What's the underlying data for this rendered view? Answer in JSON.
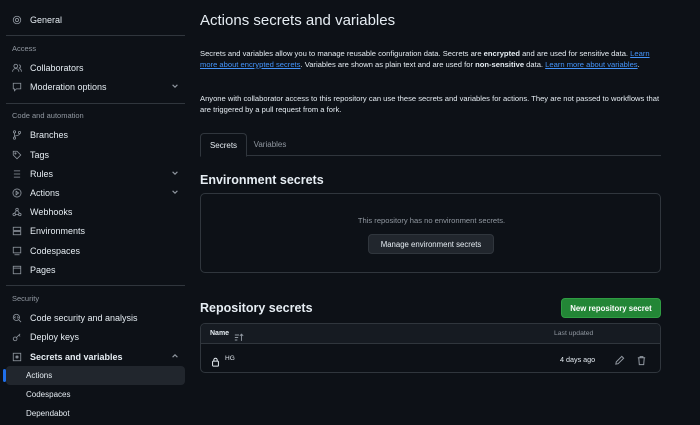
{
  "sidebar": {
    "general": "General",
    "access_heading": "Access",
    "collaborators": "Collaborators",
    "moderation": "Moderation options",
    "code_heading": "Code and automation",
    "branches": "Branches",
    "tags": "Tags",
    "rules": "Rules",
    "actions": "Actions",
    "webhooks": "Webhooks",
    "environments": "Environments",
    "codespaces": "Codespaces",
    "pages": "Pages",
    "security_heading": "Security",
    "code_security": "Code security and analysis",
    "deploy_keys": "Deploy keys",
    "secrets_vars": "Secrets and variables",
    "sub_actions": "Actions",
    "sub_codespaces": "Codespaces",
    "sub_dependabot": "Dependabot"
  },
  "main": {
    "title": "Actions secrets and variables",
    "intro": {
      "p1_a": "Secrets and variables allow you to manage reusable configuration data. Secrets are ",
      "p1_b": "encrypted",
      "p1_c": " and are used for sensitive data. ",
      "link1": "Learn more about encrypted secrets",
      "p1_d": ". Variables are shown as plain text and are used for ",
      "p1_e": "non-sensitive",
      "p1_f": " data. ",
      "link2": "Learn more about variables",
      "p1_g": "."
    },
    "intro2": "Anyone with collaborator access to this repository can use these secrets and variables for actions. They are not passed to workflows that are triggered by a pull request from a fork.",
    "tabs": [
      "Secrets",
      "Variables"
    ],
    "env_heading": "Environment secrets",
    "env_empty": "This repository has no environment secrets.",
    "env_button": "Manage environment secrets",
    "repo_heading": "Repository secrets",
    "new_button": "New repository secret",
    "table": {
      "col_name": "Name",
      "col_updated": "Last updated",
      "rows": [
        {
          "name": "HG",
          "updated": "4 days ago"
        }
      ]
    }
  },
  "colors": {
    "background": "#0d1117",
    "accent_link": "#4493f8",
    "primary_button": "#238636",
    "active_indicator": "#1f6feb"
  }
}
